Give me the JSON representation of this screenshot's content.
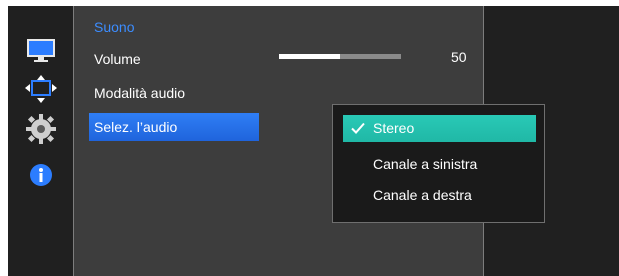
{
  "menu": {
    "title": "Suono",
    "items": [
      {
        "label": "Volume"
      },
      {
        "label": "Modalità audio"
      },
      {
        "label": "Selez. l’audio"
      }
    ],
    "volume": {
      "value": "50",
      "level_percent": 50
    }
  },
  "dropdown": {
    "options": [
      {
        "label": "Stereo",
        "selected": true
      },
      {
        "label": "Canale a sinistra",
        "selected": false
      },
      {
        "label": "Canale a destra",
        "selected": false
      }
    ]
  },
  "rail": {
    "icons": [
      {
        "name": "monitor-icon"
      },
      {
        "name": "arrows-icon"
      },
      {
        "name": "gear-icon"
      },
      {
        "name": "info-icon"
      }
    ]
  },
  "colors": {
    "menu_title": "#3c8dff",
    "selected_row": "#2f7ef5",
    "selected_option": "#29c9b6",
    "panel_bg": "#3d3d3d"
  }
}
